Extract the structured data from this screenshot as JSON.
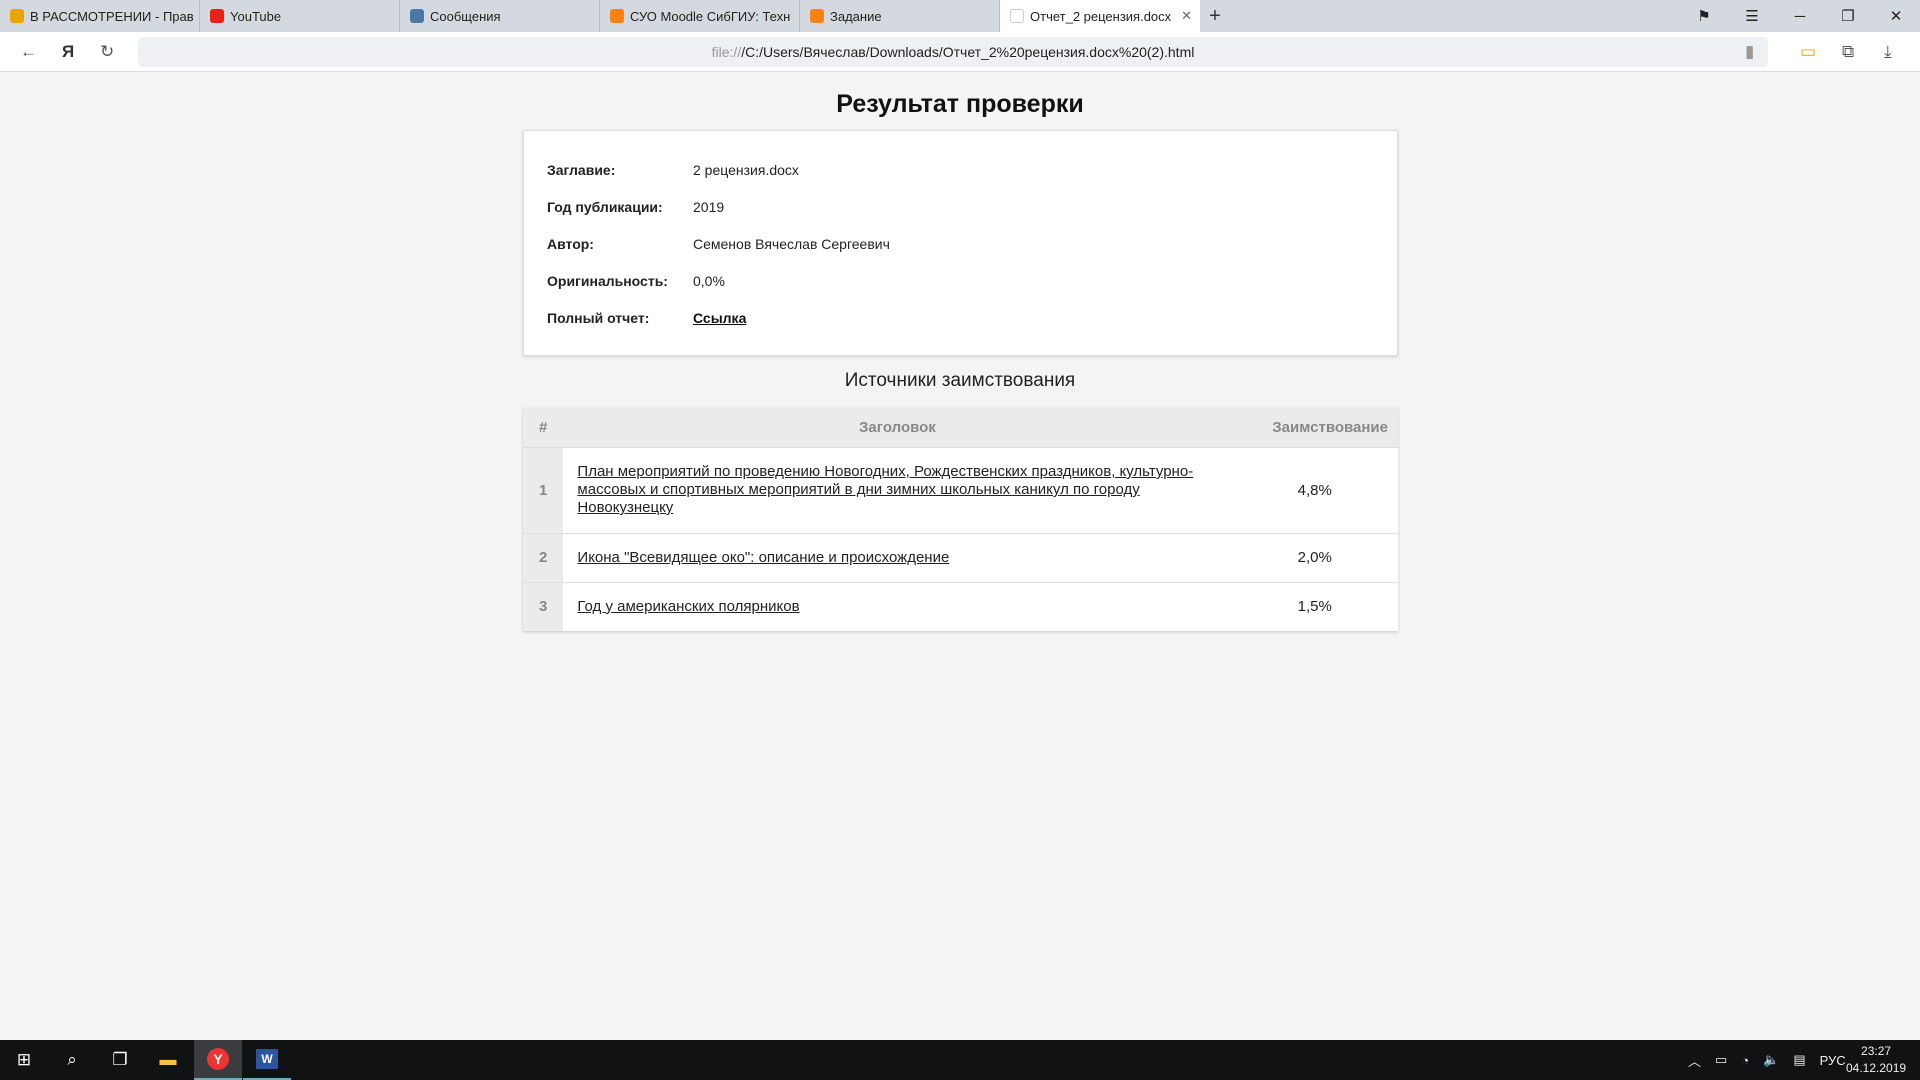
{
  "browser": {
    "tabs": [
      {
        "label": "В РАССМОТРЕНИИ - Прав",
        "icon": "rospatent-icon",
        "color": "#e8a400"
      },
      {
        "label": "YouTube",
        "icon": "youtube-icon",
        "color": "#e62117"
      },
      {
        "label": "Сообщения",
        "icon": "vk-messages-icon",
        "color": "#4a76a8"
      },
      {
        "label": "СУО Moodle СибГИУ: Техн",
        "icon": "moodle-icon",
        "color": "#f98012"
      },
      {
        "label": "Задание",
        "icon": "moodle-icon",
        "color": "#f98012"
      },
      {
        "label": "Отчет_2 рецензия.docx",
        "icon": "document-icon",
        "color": "#cccccc",
        "active": true
      }
    ],
    "url_scheme": "file://",
    "url_path": "/C:/Users/Вячеслав/Downloads/Отчет_2%20рецензия.docx%20(2).html"
  },
  "page": {
    "title": "Результат проверки",
    "fields": [
      {
        "label": "Заглавие:",
        "value": "2 рецензия.docx"
      },
      {
        "label": "Год публикации:",
        "value": "2019"
      },
      {
        "label": "Автор:",
        "value": "Семенов Вячеслав Сергеевич"
      },
      {
        "label": "Оригинальность:",
        "value": "0,0%"
      },
      {
        "label": "Полный отчет:",
        "value": "Ссылка"
      }
    ],
    "sources_title": "Источники заимствования",
    "table": {
      "headers": [
        "#",
        "Заголовок",
        "Заимствование"
      ],
      "rows": [
        {
          "num": "1",
          "title": "План мероприятий по проведению Новогодних, Рождественских праздников, культурно-массовых и спортивных мероприятий в дни зимних школьных каникул по городу Новокузнецку",
          "pct": "4,8%"
        },
        {
          "num": "2",
          "title": "Икона \"Всевидящее око\": описание и происхождение",
          "pct": "2,0%"
        },
        {
          "num": "3",
          "title": "Год у американских полярников",
          "pct": "1,5%"
        }
      ]
    }
  },
  "taskbar": {
    "time": "23:27",
    "date": "04.12.2019",
    "lang": "РУС"
  }
}
